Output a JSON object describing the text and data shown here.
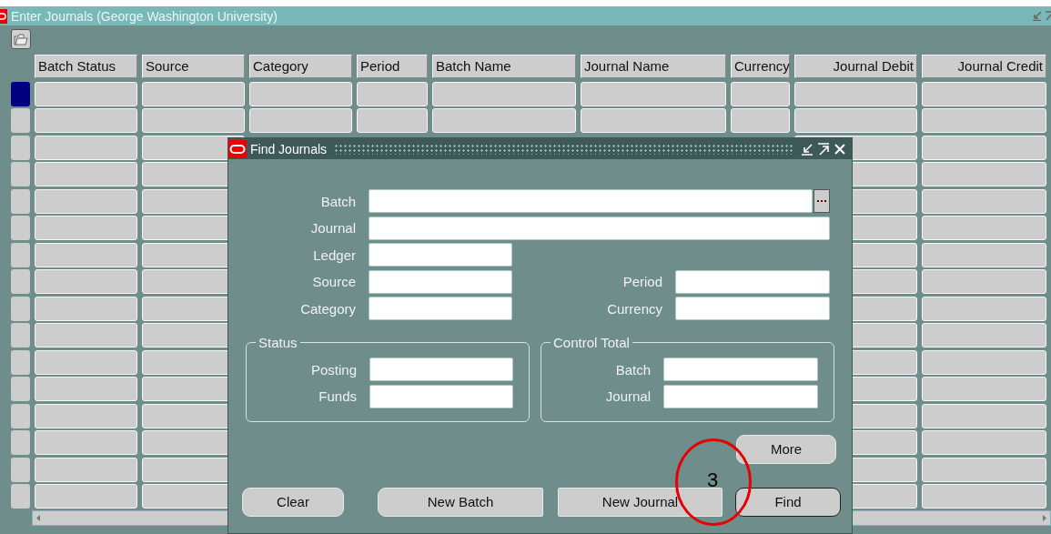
{
  "window": {
    "title": "Enter Journals (George Washington University)"
  },
  "table": {
    "columns": [
      {
        "label": "Batch Status",
        "kind": "text"
      },
      {
        "label": "Source",
        "kind": "text"
      },
      {
        "label": "Category",
        "kind": "text"
      },
      {
        "label": "Period",
        "kind": "text"
      },
      {
        "label": "Batch Name",
        "kind": "text"
      },
      {
        "label": "Journal Name",
        "kind": "text"
      },
      {
        "label": "Currency",
        "kind": "text"
      },
      {
        "label": "Journal Debit",
        "kind": "amount"
      },
      {
        "label": "Journal Credit",
        "kind": "amount"
      }
    ],
    "rows": [
      {
        "selected": true
      },
      {
        "selected": false
      },
      {
        "selected": false
      },
      {
        "selected": false
      },
      {
        "selected": false
      },
      {
        "selected": false
      },
      {
        "selected": false
      },
      {
        "selected": false
      },
      {
        "selected": false
      },
      {
        "selected": false
      },
      {
        "selected": false
      },
      {
        "selected": false
      },
      {
        "selected": false
      },
      {
        "selected": false
      },
      {
        "selected": false
      },
      {
        "selected": false
      }
    ]
  },
  "dialog": {
    "title": "Find Journals",
    "form_rows": [
      [
        {
          "label": "Batch",
          "kind": "lov"
        }
      ],
      [
        {
          "label": "Journal",
          "kind": "wide"
        }
      ],
      [
        {
          "label": "Ledger",
          "kind": "short"
        }
      ],
      [
        {
          "label": "Source",
          "kind": "short"
        },
        {
          "label": "Period",
          "kind": "short"
        }
      ],
      [
        {
          "label": "Category",
          "kind": "short"
        },
        {
          "label": "Currency",
          "kind": "short"
        }
      ]
    ],
    "groups": [
      {
        "title": "Status",
        "fields": [
          {
            "label": "Posting"
          },
          {
            "label": "Funds"
          }
        ]
      },
      {
        "title": "Control Total",
        "fields": [
          {
            "label": "Batch"
          },
          {
            "label": "Journal"
          }
        ]
      }
    ],
    "more_button": {
      "label": "More"
    },
    "buttons": [
      {
        "label": "Clear",
        "default": false
      },
      {
        "label": "New Batch",
        "default": false
      },
      {
        "label": "New Journal",
        "default": false
      },
      {
        "label": "Find",
        "default": true
      }
    ]
  },
  "annotation": {
    "label": "3"
  }
}
